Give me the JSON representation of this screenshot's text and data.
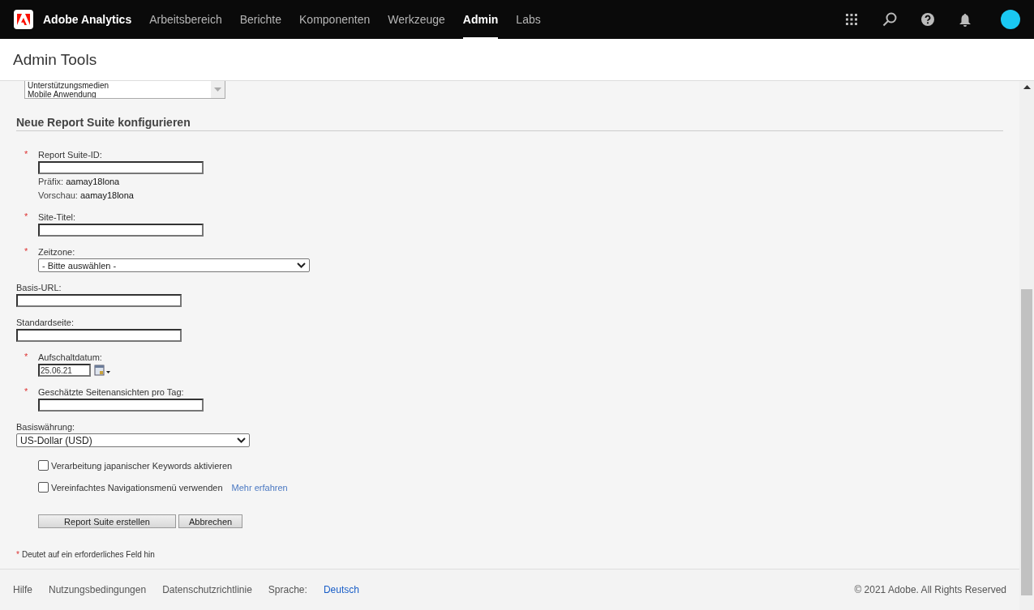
{
  "nav": {
    "brand": "Adobe Analytics",
    "items": [
      {
        "label": "Arbeitsbereich",
        "selected": false
      },
      {
        "label": "Berichte",
        "selected": false
      },
      {
        "label": "Komponenten",
        "selected": false
      },
      {
        "label": "Werkzeuge",
        "selected": false
      },
      {
        "label": "Admin",
        "selected": true
      },
      {
        "label": "Labs",
        "selected": false
      }
    ]
  },
  "page_title": "Admin Tools",
  "media_list": {
    "options": [
      {
        "label": "Unterstützungsmedien",
        "selected": false
      },
      {
        "label": "Mobile Anwendung",
        "selected": false
      }
    ]
  },
  "section_title": "Neue Report Suite konfigurieren",
  "fields": [
    {
      "kind": "text",
      "label": "Report Suite-ID:",
      "required_mark": "*",
      "notes": [
        {
          "label": "Präfix:",
          "value": "aamay18lona"
        },
        {
          "label": "Vorschau:",
          "value": "aamay18lona"
        }
      ]
    },
    {
      "kind": "text",
      "label": "Site-Titel:",
      "required_mark": "*"
    },
    {
      "kind": "select",
      "label": "Zeitzone:",
      "required_mark": "*",
      "value": "- Bitte auswählen -"
    },
    {
      "kind": "text",
      "label": "Basis-URL:"
    },
    {
      "kind": "text",
      "label": "Standardseite:"
    },
    {
      "kind": "date",
      "label": "Aufschaltdatum:",
      "required_mark": "*",
      "value": "25.06.21"
    },
    {
      "kind": "text",
      "label": "Geschätzte Seitenansichten pro Tag:",
      "required_mark": "*"
    },
    {
      "kind": "currency",
      "label": "Basiswährung:",
      "value": "US-Dollar (USD)"
    }
  ],
  "checkboxes": [
    {
      "label": "Verarbeitung japanischer Keywords aktivieren",
      "checked": false
    },
    {
      "label": "Vereinfachtes Navigationsmenü verwenden",
      "checked": false,
      "link": "Mehr erfahren"
    }
  ],
  "buttons": [
    "Report Suite erstellen",
    "Abbrechen"
  ],
  "footnote": {
    "mark": "*",
    "text": "Deutet auf ein erforderliches Feld hin"
  },
  "footer": {
    "links": [
      "Hilfe",
      "Nutzungsbedingungen",
      "Datenschutzrichtlinie"
    ],
    "language_label": "Sprache:",
    "language": "Deutsch",
    "copyright": "© 2021 Adobe. All Rights Reserved"
  }
}
